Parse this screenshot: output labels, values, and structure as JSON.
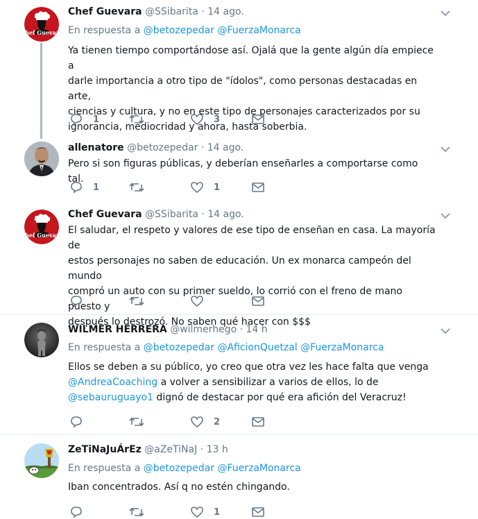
{
  "tweets": [
    {
      "name": "Chef Guevara",
      "handle": "@SSibarita",
      "time": "14 ago.",
      "reply_prefix": "En respuesta a",
      "reply_to": [
        "@betozepedar",
        "@FuerzaMonarca"
      ],
      "lines": [
        "Ya tienen tiempo comportándose así. Ojalá que la gente algún día empiece a",
        "darle importancia a otro tipo de \"ídolos\", como personas destacadas en arte,",
        "ciencias y cultura, y no en este tipo de personajes caracterizados por su",
        "ignorancia, mediocridad y ahora, hasta soberbia."
      ],
      "replies": "1",
      "retweets": "",
      "likes": "3"
    },
    {
      "name": "allenatore",
      "handle": "@betozepedar",
      "time": "14 ago.",
      "lines": [
        "Pero si son figuras públicas, y deberían enseñarles a comportarse como tal."
      ],
      "replies": "1",
      "retweets": "",
      "likes": "1"
    },
    {
      "name": "Chef Guevara",
      "handle": "@SSibarita",
      "time": "14 ago.",
      "lines": [
        "El saludar, el respeto y valores de ese tipo de enseñan en casa. La mayoría de",
        "estos personajes no saben de educación. Un ex monarca campeón del mundo",
        "compró un auto con su primer sueldo, lo corrió con el freno de mano puesto y",
        "después lo destrozó. No saben qué hacer con $$$"
      ],
      "replies": "",
      "retweets": "",
      "likes": ""
    },
    {
      "name": "WILMER HERRERA",
      "handle": "@wilmerhego",
      "time": "14 h",
      "reply_prefix": "En respuesta a",
      "reply_to": [
        "@betozepedar",
        "@AficionQuetzal",
        "@FuerzaMonarca"
      ],
      "line1": "Ellos se deben a su público, yo creo que otra vez les hace falta que venga",
      "mention1": "@AndreaCoaching",
      "line2": " a volver a sensibilizar a varios de ellos, lo de",
      "mention2": "@sebauruguayo1",
      "line3": " dignó de destacar por qué era afición del Veracruz!",
      "replies": "",
      "retweets": "",
      "likes": "2"
    },
    {
      "name": "ZeTiNaJuÁrEz",
      "handle": "@aZeTiNaJ",
      "time": "13 h",
      "reply_prefix": "En respuesta a",
      "reply_to": [
        "@betozepedar",
        "@FuerzaMonarca"
      ],
      "lines": [
        "Iban concentrados. Así q no estén chingando."
      ],
      "replies": "",
      "retweets": "",
      "likes": "1"
    }
  ],
  "dot": "·",
  "avatars": {
    "chef": "Chef Guevara",
    "chef_logo_text": "Chef Guevara"
  },
  "colors": {
    "link": "#1b95e0",
    "muted": "#657786",
    "thread_line": "#aab8c2",
    "divider": "#e6ecf0",
    "chef_red": "#c4161c"
  },
  "icons": [
    "reply-icon",
    "retweet-icon",
    "like-icon",
    "message-icon",
    "chevron-down-icon"
  ]
}
